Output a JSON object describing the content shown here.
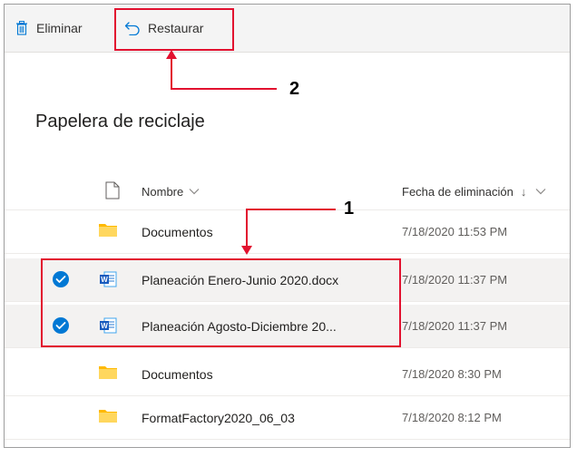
{
  "commandbar": {
    "delete_label": "Eliminar",
    "restore_label": "Restaurar"
  },
  "callouts": {
    "one": "1",
    "two": "2"
  },
  "page": {
    "title": "Papelera de reciclaje"
  },
  "columns": {
    "name": "Nombre",
    "deleted_date": "Fecha de eliminación",
    "sort_arrow": "↓"
  },
  "rows": [
    {
      "name": "Documentos",
      "date": "7/18/2020 11:53 PM",
      "type": "folder",
      "selected": false
    },
    {
      "name": "Planeación Enero-Junio 2020.docx",
      "date": "7/18/2020 11:37 PM",
      "type": "word",
      "selected": true
    },
    {
      "name": "Planeación Agosto-Diciembre 20...",
      "date": "7/18/2020 11:37 PM",
      "type": "word",
      "selected": true
    },
    {
      "name": "Documentos",
      "date": "7/18/2020 8:30 PM",
      "type": "folder",
      "selected": false
    },
    {
      "name": "FormatFactory2020_06_03",
      "date": "7/18/2020 8:12 PM",
      "type": "folder",
      "selected": false
    }
  ],
  "colors": {
    "accent": "#0078d4",
    "highlight": "#e2112f",
    "folder": "#ffb900"
  }
}
